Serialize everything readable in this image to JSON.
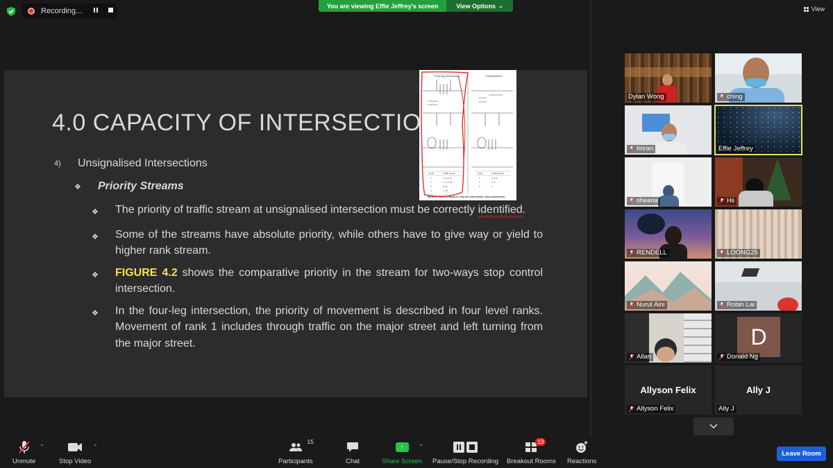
{
  "top": {
    "recording_label": "Recording...",
    "viewing_banner": "You are viewing Effie Jeffrey's screen",
    "view_options": "View Options",
    "view_label": "View"
  },
  "slide": {
    "title": "4.0 CAPACITY OF INTERSECTIONS",
    "level1_number": "4)",
    "level1_text": "Unsignalised Intersections",
    "level2_text": "Priority Streams",
    "bullet1_before": "The priority of traffic stream at unsignalised intersection must be ",
    "bullet1_word1": "correctly",
    "bullet1_word2": "identified",
    "bullet1_after": ".",
    "bullet2": "Some of the streams have absolute priority, while others have to give way or yield to higher rank stream.",
    "bullet3_highlight": "FIGURE 4.2",
    "bullet3_rest": " shows the comparative priority in the stream for two-ways stop control intersection.",
    "bullet4": "In the four-leg intersection, the priority of movement is described in four level ranks. Movement of rank 1 includes through traffic on the major street and left turning from the major street.",
    "figure": {
      "label_left": "Four-leg intersection",
      "label_right": "T-intersection",
      "table_head_rank": "Rank",
      "table_head_stream": "Traffic stream",
      "left_rows": [
        [
          "1",
          "2, 3, 5, 6"
        ],
        [
          "2",
          "1, 4, 9, 12"
        ],
        [
          "3",
          "8, 11"
        ],
        [
          "4",
          "7, 10"
        ]
      ],
      "right_rows": [
        [
          "1",
          "2, 3, 5"
        ],
        [
          "2",
          "4, 6"
        ],
        [
          "3",
          "7"
        ]
      ],
      "caption": "FIGURE 4.2: TRAFFIC STREAMS AT A TWO-WAY STOP CONTROL (TWSC) INTERSECTION"
    }
  },
  "participants": [
    {
      "name": "Dylan Wong",
      "muted": false
    },
    {
      "name": "ching",
      "muted": true
    },
    {
      "name": "Imran",
      "muted": true
    },
    {
      "name": "Effie Jeffrey",
      "muted": false
    },
    {
      "name": "sheena",
      "muted": true
    },
    {
      "name": "Hii",
      "muted": true
    },
    {
      "name": "RENDELL",
      "muted": true
    },
    {
      "name": "LOONG25",
      "muted": true
    },
    {
      "name": "Nurul Aini",
      "muted": true
    },
    {
      "name": "Robin Lai",
      "muted": true
    },
    {
      "name": "Allan",
      "muted": true
    },
    {
      "name": "Donald Ng",
      "muted": true
    },
    {
      "name": "Allyson Felix",
      "muted": true
    },
    {
      "name": "Ally J",
      "muted": false
    }
  ],
  "avatar_letter": "D",
  "toolbar": {
    "unmute": "Unmute",
    "stop_video": "Stop Video",
    "participants": "Participants",
    "participants_count": "15",
    "chat": "Chat",
    "share_screen": "Share Screen",
    "pause_stop_recording": "Pause/Stop Recording",
    "breakout_rooms": "Breakout Rooms",
    "breakout_badge": "13",
    "reactions": "Reactions",
    "leave_room": "Leave Room"
  },
  "colors": {
    "share_green": "#23c34a",
    "banner_green": "#24a13c",
    "leave_blue": "#1d5fd6",
    "highlight_yellow": "#f6e14a",
    "active_speaker": "#ece25a"
  }
}
